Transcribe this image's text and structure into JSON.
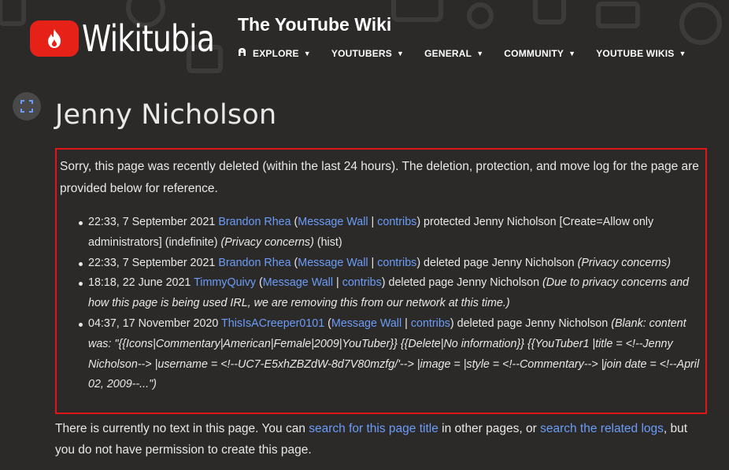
{
  "header": {
    "logo_text": "Wikitubia",
    "wiki_title": "The YouTube Wiki",
    "nav": [
      {
        "label": "EXPLORE"
      },
      {
        "label": "YOUTUBERS"
      },
      {
        "label": "GENERAL"
      },
      {
        "label": "COMMUNITY"
      },
      {
        "label": "YOUTUBE WIKIS"
      }
    ]
  },
  "page": {
    "title": "Jenny Nicholson"
  },
  "notice": {
    "intro": "Sorry, this page was recently deleted (within the last 24 hours). The deletion, protection, and move log for the page are provided below for reference.",
    "entries": [
      {
        "timestamp": "22:33, 7 September 2021",
        "user": "Brandon Rhea",
        "message_wall": "Message Wall",
        "contribs": "contribs",
        "action": "protected Jenny Nicholson [Create=Allow only administrators] (indefinite)",
        "reason": "(Privacy concerns)",
        "extra": "(hist)"
      },
      {
        "timestamp": "22:33, 7 September 2021",
        "user": "Brandon Rhea",
        "message_wall": "Message Wall",
        "contribs": "contribs",
        "action": "deleted page Jenny Nicholson",
        "reason": "(Privacy concerns)",
        "extra": ""
      },
      {
        "timestamp": "18:18, 22 June 2021",
        "user": "TimmyQuivy",
        "message_wall": "Message Wall",
        "contribs": "contribs",
        "action": "deleted page Jenny Nicholson",
        "reason": "(Due to privacy concerns and how this page is being used IRL, we are removing this from our network at this time.)",
        "extra": ""
      },
      {
        "timestamp": "04:37, 17 November 2020",
        "user": "ThisIsACreeper0101",
        "message_wall": "Message Wall",
        "contribs": "contribs",
        "action": "deleted page Jenny Nicholson",
        "reason": "(Blank: content was: \"{{Icons|Commentary|American|Female|2009|YouTuber}} {{Delete|No information}} {{YouTuber1 |title = <!--Jenny Nicholson--> |username = <!--UC7-E5xhZBZdW-8d7V80mzfg/'--> |image = |style = <!--Commentary--> |join date = <!--April 02, 2009--...\")",
        "extra": ""
      }
    ]
  },
  "footer": {
    "text_1": "There is currently no text in this page. You can",
    "link_1": "search for this page title",
    "text_2": "in other pages, or",
    "link_2": "search the related logs",
    "text_3": ", but you do not have permission to create this page."
  },
  "colors": {
    "background": "#2b2a29",
    "link": "#6b9cf8",
    "notice_border": "#e0161a",
    "brand_red": "#e62117"
  },
  "icons": {
    "logo": "youtube-flame-logo-icon",
    "explore": "explore-icon",
    "caret": "caret-down-icon",
    "side_button": "expand-icon"
  }
}
